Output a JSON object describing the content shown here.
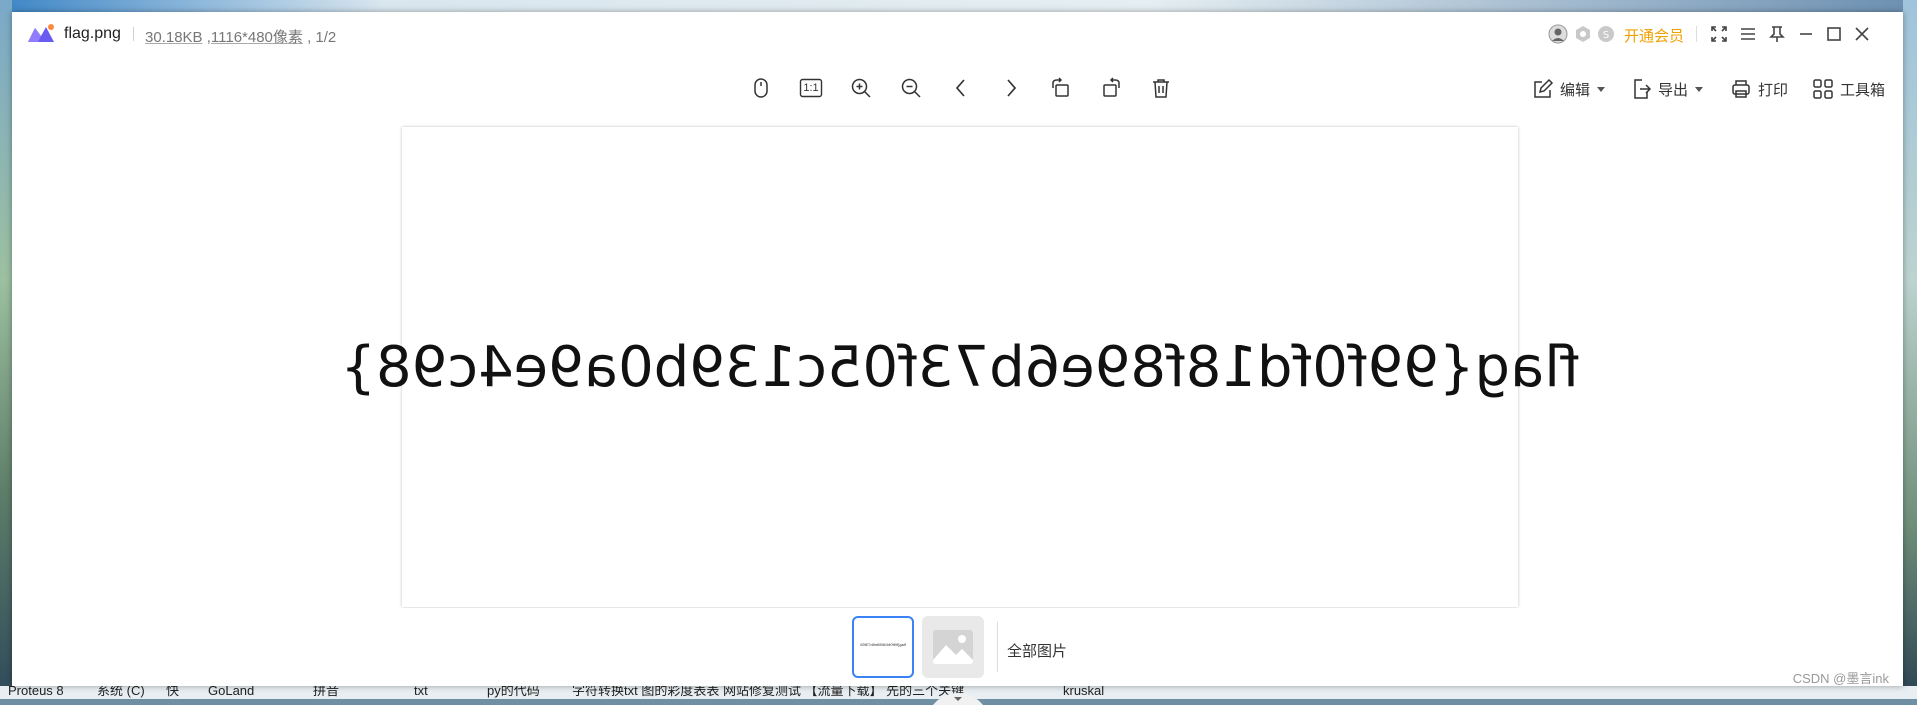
{
  "window": {
    "file_name": "flag.png",
    "file_size": "30.18KB",
    "file_dims": "1116*480像素",
    "page_index": "1/2",
    "vip_label": "开通会员"
  },
  "toolbar": {
    "ratio_label": "1:1",
    "edit_label": "编辑",
    "export_label": "导出",
    "print_label": "打印",
    "toolbox_label": "工具箱"
  },
  "image": {
    "text": "flag{99f0fd18f89e6b73f05c139b0a9e4c98}",
    "mirrored": true
  },
  "thumbnails": {
    "all_label": "全部图片"
  },
  "taskbar": {
    "items": [
      "Proteus 8",
      "系统 (C)",
      "快",
      "GoLand",
      "拼音",
      "txt",
      "py的代码",
      "字符转换txt 图的彩度表表 网站修复测试 【流量下载】 先的三个关键",
      "kruskal"
    ]
  },
  "watermark": "CSDN @墨言ink",
  "colors": {
    "accent": "#3b82f6",
    "vip": "#f0a000"
  }
}
